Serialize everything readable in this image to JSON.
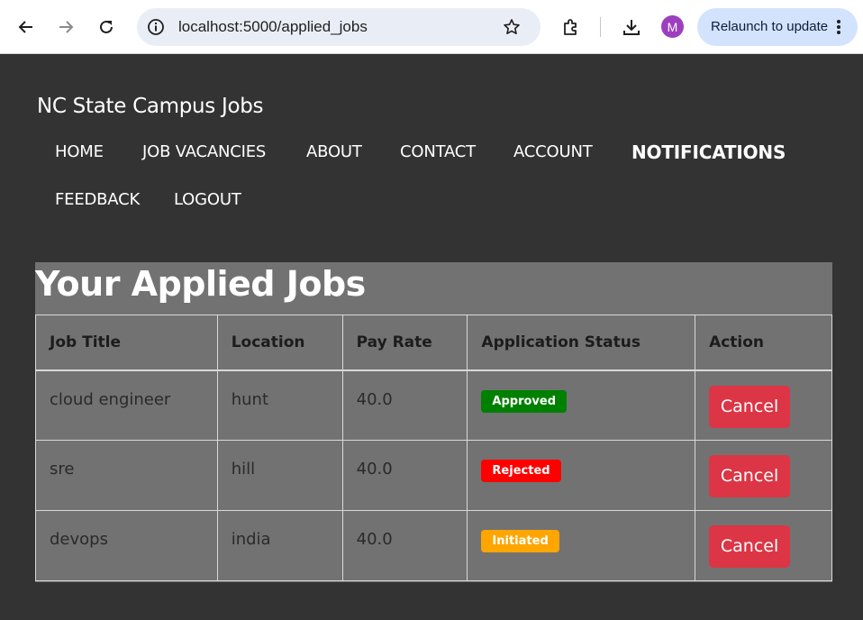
{
  "browser": {
    "url": "localhost:5000/applied_jobs",
    "profile_initial": "M",
    "relaunch_label": "Relaunch to update",
    "icons": [
      "back-icon",
      "forward-icon",
      "reload-icon",
      "site-info-icon",
      "bookmark-star-icon",
      "extensions-icon",
      "download-icon",
      "more-vert-icon"
    ]
  },
  "site": {
    "title": "NC State Campus Jobs",
    "nav": [
      {
        "label": "HOME"
      },
      {
        "label": "JOB VACANCIES"
      },
      {
        "label": "ABOUT"
      },
      {
        "label": "CONTACT"
      },
      {
        "label": "ACCOUNT"
      },
      {
        "label": "NOTIFICATIONS",
        "active": true
      },
      {
        "label": "FEEDBACK"
      },
      {
        "label": "LOGOUT"
      }
    ]
  },
  "main": {
    "heading": "Your Applied Jobs",
    "columns": [
      "Job Title",
      "Location",
      "Pay Rate",
      "Application Status",
      "Action"
    ],
    "rows": [
      {
        "job_title": "cloud engineer",
        "location": "hunt",
        "pay_rate": "40.0",
        "status": "Approved",
        "action": "Cancel"
      },
      {
        "job_title": "sre",
        "location": "hill",
        "pay_rate": "40.0",
        "status": "Rejected",
        "action": "Cancel"
      },
      {
        "job_title": "devops",
        "location": "india",
        "pay_rate": "40.0",
        "status": "Initiated",
        "action": "Cancel"
      }
    ]
  },
  "colors": {
    "page_bg": "#333333",
    "panel_bg": "#727272",
    "approved": "#008000",
    "rejected": "#ff0000",
    "initiated": "#ffa500",
    "cancel_button": "#dc3545"
  }
}
